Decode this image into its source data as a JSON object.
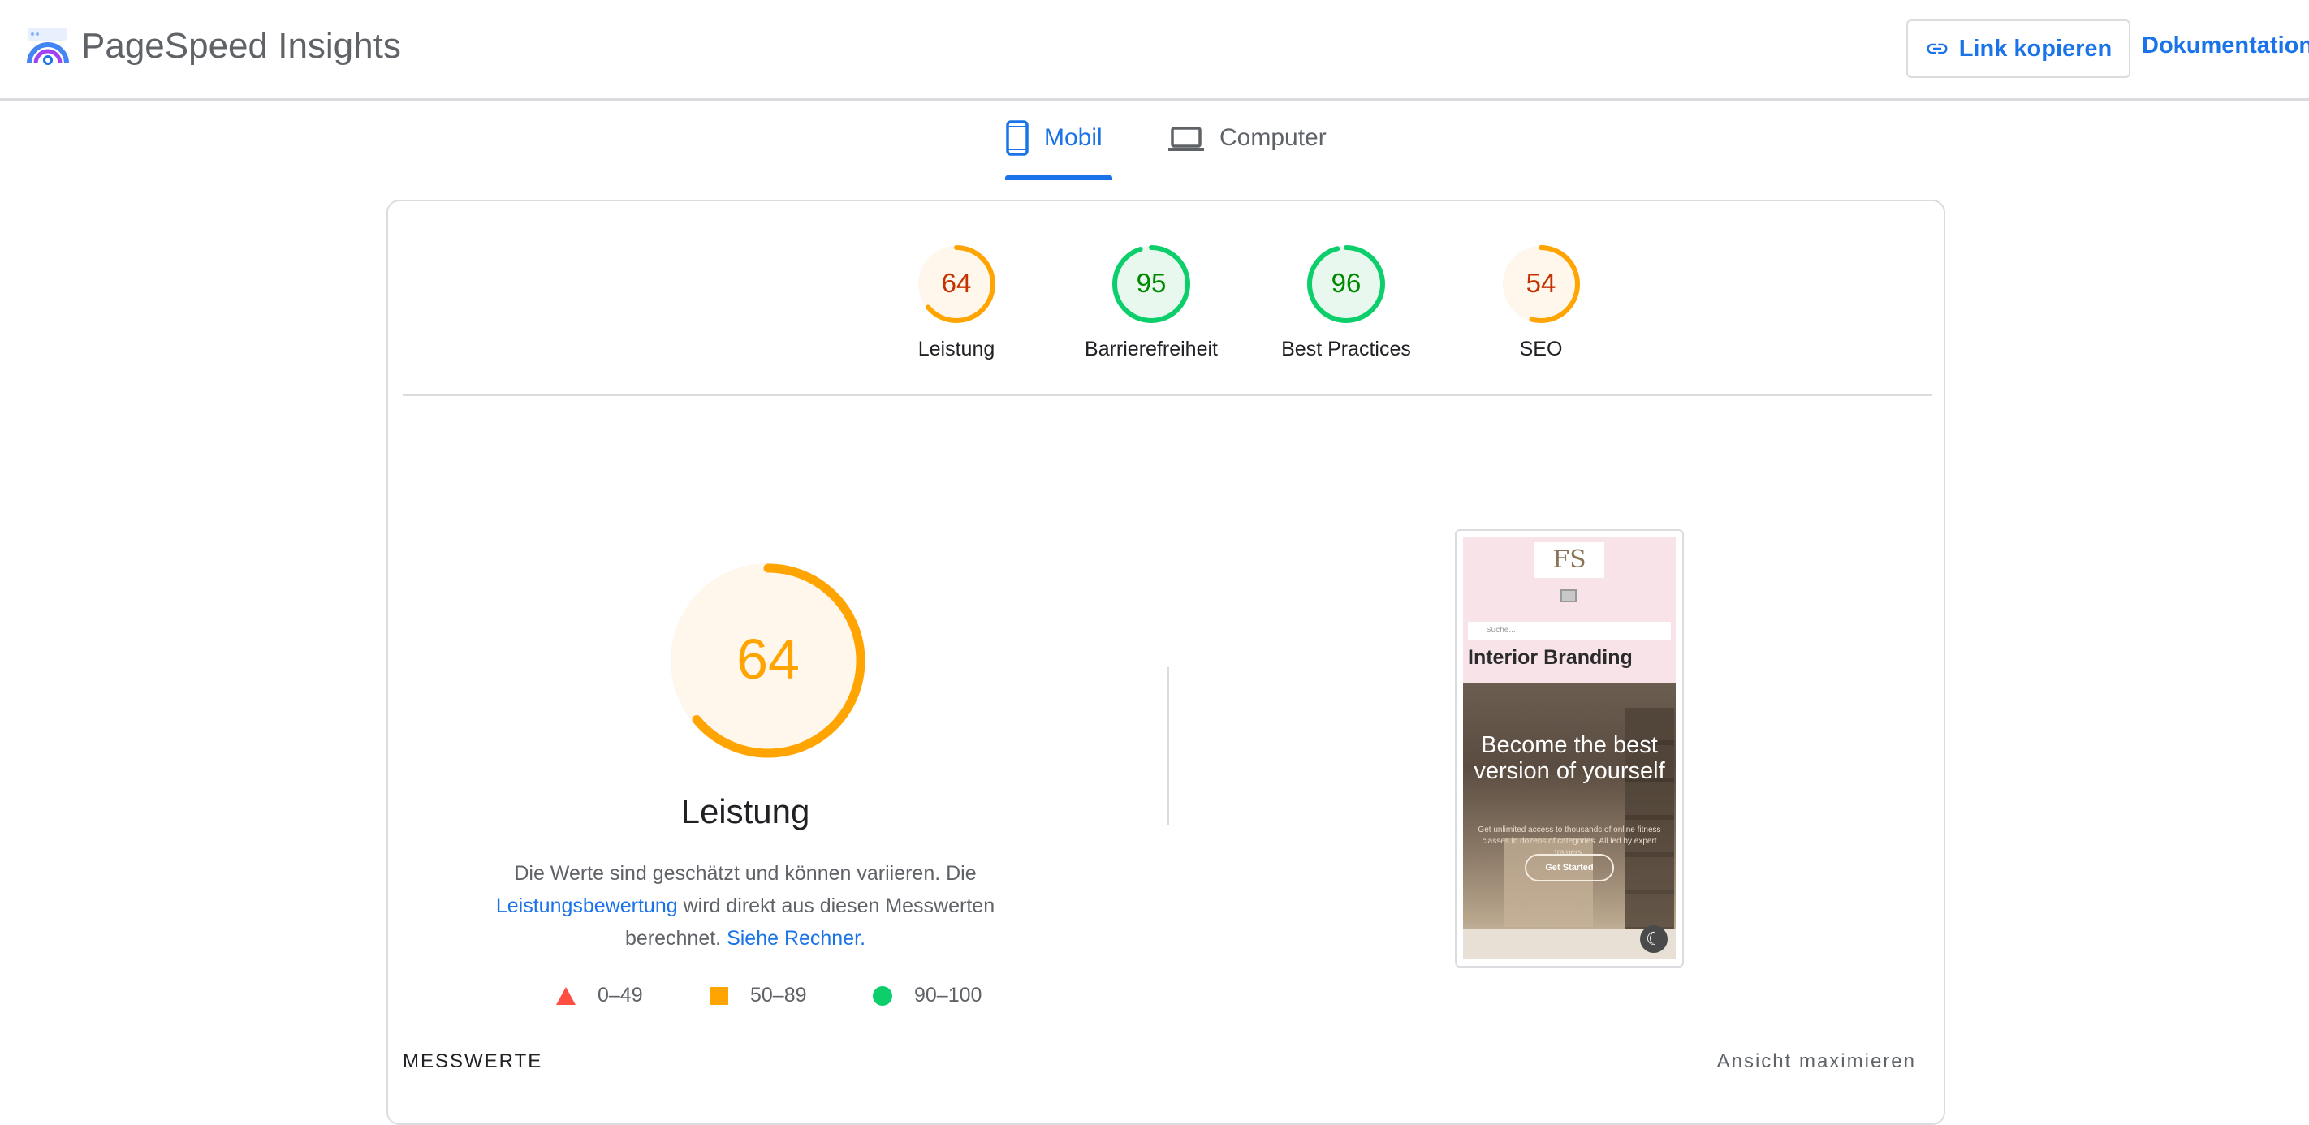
{
  "header": {
    "title": "PageSpeed Insights",
    "copy_link_label": "Link kopieren",
    "docs_label": "Dokumentation"
  },
  "tabs": [
    {
      "label": "Mobil",
      "icon": "smartphone-icon",
      "active": true
    },
    {
      "label": "Computer",
      "icon": "laptop-icon",
      "active": false
    }
  ],
  "scores": [
    {
      "label": "Leistung",
      "value": "64",
      "status": "average",
      "color": "#ffa400",
      "text_color": "#c33300",
      "bg": "#fff6ec",
      "fraction": 0.64
    },
    {
      "label": "Barrierefreiheit",
      "value": "95",
      "status": "pass",
      "color": "#0cce6b",
      "text_color": "#008800",
      "bg": "#e9f8ef",
      "fraction": 0.95
    },
    {
      "label": "Best Practices",
      "value": "96",
      "status": "pass",
      "color": "#0cce6b",
      "text_color": "#008800",
      "bg": "#e9f8ef",
      "fraction": 0.96
    },
    {
      "label": "SEO",
      "value": "54",
      "status": "average",
      "color": "#ffa400",
      "text_color": "#c33300",
      "bg": "#fff6ec",
      "fraction": 0.54
    }
  ],
  "performance": {
    "score": "64",
    "fraction": 0.64,
    "color": "#ffa400",
    "title": "Leistung",
    "desc_part1": "Die Werte sind geschätzt und können variieren. Die ",
    "desc_link1": "Leistungsbewertung",
    "desc_part2": " wird direkt aus diesen Messwerten berechnet. ",
    "desc_link2": "Siehe Rechner."
  },
  "legend": [
    {
      "range": "0–49",
      "shape": "triangle",
      "color": "#ff4e42"
    },
    {
      "range": "50–89",
      "shape": "square",
      "color": "#ffa400"
    },
    {
      "range": "90–100",
      "shape": "circle",
      "color": "#0cce6b"
    }
  ],
  "preview": {
    "logo": "FS",
    "search_placeholder": "Suche...",
    "heading": "Interior Branding",
    "hero_text": "Become the best version of yourself",
    "small_text": "Get unlimited access to thousands of online fitness classes in dozens of categories. All led by expert trainers.",
    "cta": "Get Started"
  },
  "metrics": {
    "title": "MESSWERTE",
    "expand_label": "Ansicht maximieren"
  },
  "colors": {
    "accent": "#1a73e8",
    "border": "#dadce0"
  }
}
